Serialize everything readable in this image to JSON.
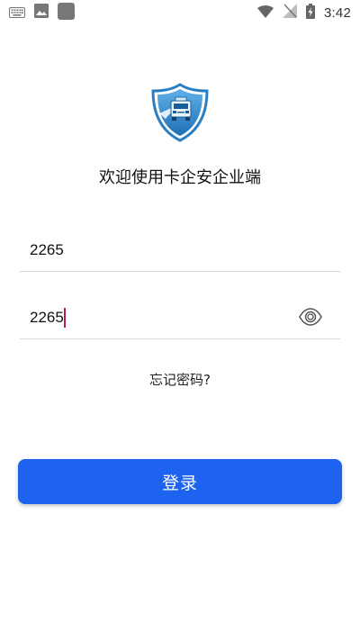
{
  "status_bar": {
    "time": "3:42",
    "left_icons": [
      "keyboard-icon",
      "image-icon",
      "app-square-icon"
    ],
    "right_icons": [
      "wifi-icon",
      "no-signal-icon",
      "battery-charging-icon"
    ]
  },
  "welcome_text": "欢迎使用卡企安企业端",
  "account_field": {
    "value": "2265"
  },
  "password_field": {
    "value": "2265"
  },
  "forgot_password": "忘记密码?",
  "login_button": "登录",
  "colors": {
    "primary": "#1e62f0",
    "caret": "#c2185b",
    "logo_blue": "#2a7fc4"
  }
}
